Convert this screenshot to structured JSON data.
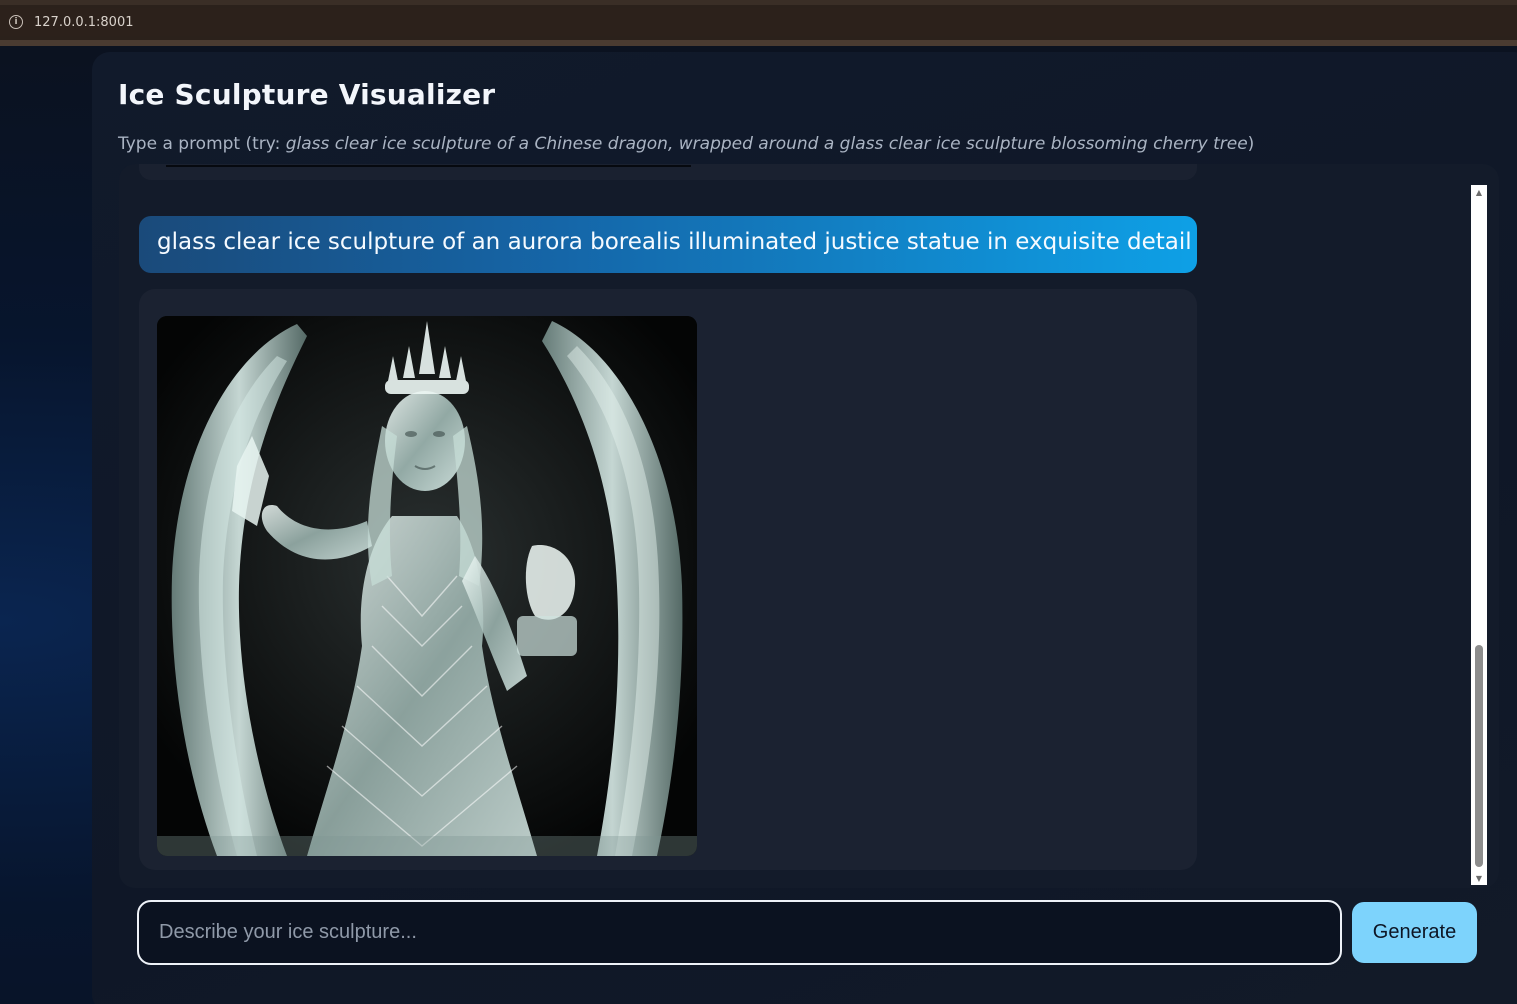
{
  "browser": {
    "url": "127.0.0.1:8001",
    "icon": "info-icon"
  },
  "app": {
    "title": "Ice Sculpture Visualizer",
    "subtitle_prefix": "Type a prompt (try: ",
    "subtitle_example": "glass clear ice sculpture of a Chinese dragon, wrapped around a glass clear ice sculpture blossoming cherry tree",
    "subtitle_suffix": ")"
  },
  "chat": {
    "messages": [
      {
        "role": "user",
        "text": "glass clear ice sculpture of an aurora borealis illuminated justice statue in exquisite detail"
      },
      {
        "role": "assistant",
        "content": "generated-ice-sculpture-image"
      }
    ]
  },
  "composer": {
    "placeholder": "Describe your ice sculpture...",
    "value": "",
    "submit_label": "Generate"
  },
  "colors": {
    "accent": "#7dd3fc",
    "user_bubble_start": "#1a4a7a",
    "user_bubble_end": "#0ea0e6",
    "panel": "#131b2a"
  }
}
